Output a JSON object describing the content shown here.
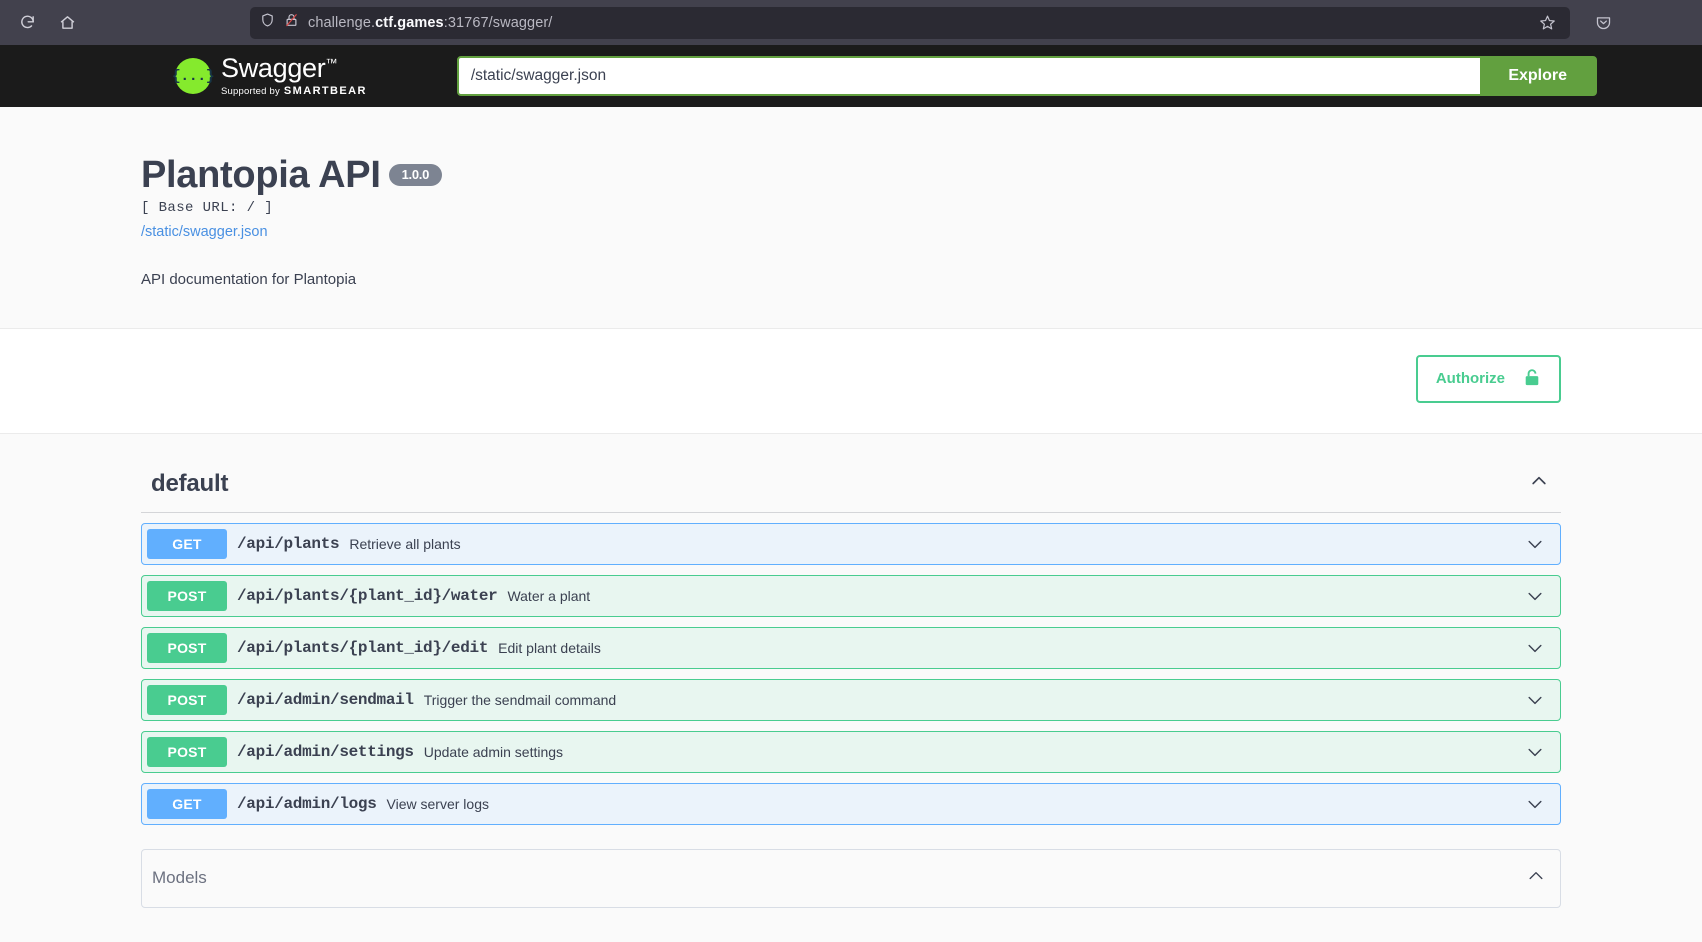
{
  "browser": {
    "reload_icon": "reload-icon",
    "home_icon": "home-icon",
    "shield_icon": "shield-icon",
    "lock_broken_icon": "insecure-lock-icon",
    "url_prefix": "challenge.",
    "url_domain": "ctf.games",
    "url_suffix": ":31767/swagger/",
    "url_full": "challenge.ctf.games:31767/swagger/",
    "bookmark_icon": "star-icon",
    "pocket_icon": "pocket-icon"
  },
  "topbar": {
    "logo_glyph": "{...}",
    "logo_name": "Swagger",
    "logo_tm": "™",
    "supported_by": "Supported by",
    "smartbear": "SMARTBEAR",
    "url_value": "/static/swagger.json",
    "url_placeholder": "/static/swagger.json",
    "explore_label": "Explore"
  },
  "info": {
    "title": "Plantopia API",
    "version": "1.0.0",
    "base_url": "[ Base URL: / ]",
    "spec_link": "/static/swagger.json",
    "description": "API documentation for Plantopia"
  },
  "auth": {
    "authorize_label": "Authorize",
    "lock_icon": "unlocked-padlock-icon"
  },
  "tag": {
    "name": "default",
    "collapse_icon": "chevron-up-icon"
  },
  "operations": [
    {
      "method": "GET",
      "method_class": "get",
      "path": "/api/plants",
      "summary": "Retrieve all plants",
      "expand_icon": "chevron-down-icon"
    },
    {
      "method": "POST",
      "method_class": "post",
      "path": "/api/plants/{plant_id}/water",
      "summary": "Water a plant",
      "expand_icon": "chevron-down-icon"
    },
    {
      "method": "POST",
      "method_class": "post",
      "path": "/api/plants/{plant_id}/edit",
      "summary": "Edit plant details",
      "expand_icon": "chevron-down-icon"
    },
    {
      "method": "POST",
      "method_class": "post",
      "path": "/api/admin/sendmail",
      "summary": "Trigger the sendmail command",
      "expand_icon": "chevron-down-icon"
    },
    {
      "method": "POST",
      "method_class": "post",
      "path": "/api/admin/settings",
      "summary": "Update admin settings",
      "expand_icon": "chevron-down-icon"
    },
    {
      "method": "GET",
      "method_class": "get",
      "path": "/api/admin/logs",
      "summary": "View server logs",
      "expand_icon": "chevron-down-icon"
    }
  ],
  "models": {
    "title": "Models",
    "collapse_icon": "chevron-up-icon"
  },
  "colors": {
    "swagger_green": "#85ea2d",
    "explore_green": "#62a03f",
    "get_blue": "#61affe",
    "post_green": "#49cc90",
    "text_dark": "#3b4151",
    "link_blue": "#4990e2",
    "badge_gray": "#7d8492"
  }
}
